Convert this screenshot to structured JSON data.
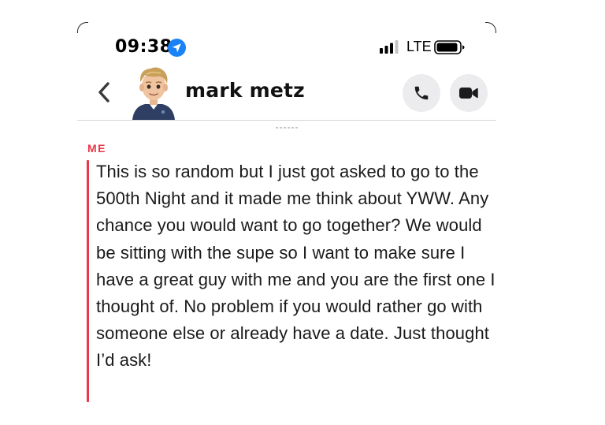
{
  "status_bar": {
    "time": "09:38",
    "network": "LTE",
    "location_icon": "location-arrow-icon",
    "signal_icon": "cellular-signal-icon",
    "battery_icon": "battery-icon"
  },
  "header": {
    "contact_name": "mark metz",
    "back_icon": "chevron-left-icon",
    "call_icon": "phone-icon",
    "video_icon": "video-camera-icon"
  },
  "conversation": {
    "sender_label": "ME",
    "sender_color": "#e8364a",
    "message": "This is so random but I just got asked to go to the 500th Night and it made me think about YWW. Any chance you would want to go together? We would be sitting with the supe so I want to make sure I have a great guy with me and you are the first one I thought of. No problem if you would rather go with someone else or already have a date. Just thought I’d ask!"
  },
  "colors": {
    "accent_red": "#e8364a",
    "location_blue": "#1a82f7",
    "button_bg": "#ececee"
  }
}
